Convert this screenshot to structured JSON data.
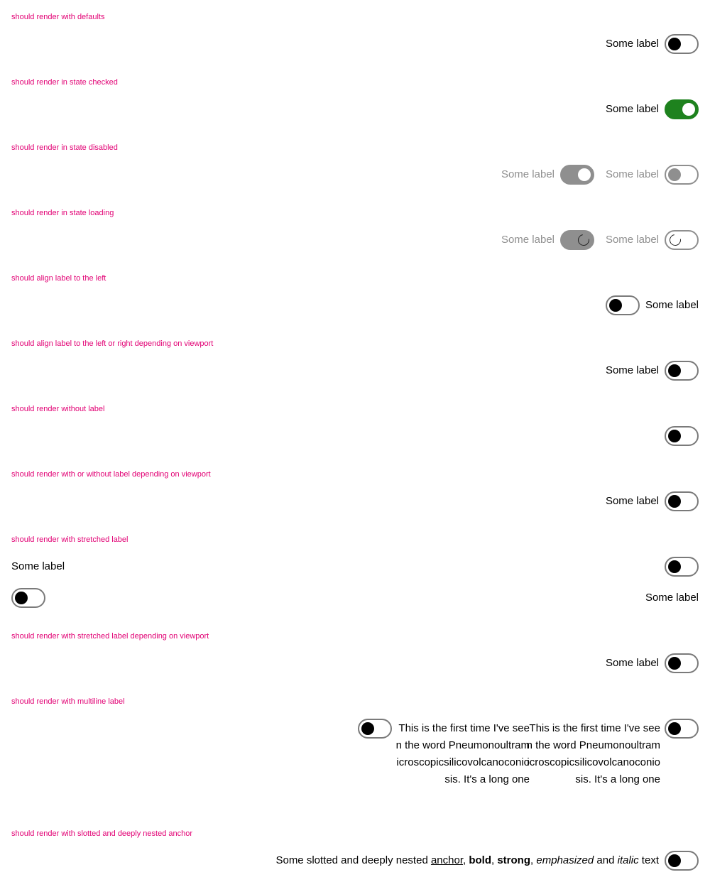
{
  "sections": {
    "defaults": "should render with defaults",
    "checked": "should render in state checked",
    "disabled": "should render in state disabled",
    "loading": "should render in state loading",
    "align_left": "should align label to the left",
    "align_viewport": "should align label to the left or right depending on viewport",
    "without_label": "should render without label",
    "with_or_without": "should render with or without label depending on viewport",
    "stretched": "should render with stretched label",
    "stretched_viewport": "should render with stretched label depending on viewport",
    "multiline": "should render with multiline label",
    "slotted": "should render with slotted and deeply nested anchor"
  },
  "label": "Some label",
  "switch_states": {
    "defaults": "off",
    "checked": "on",
    "disabled": [
      "disabled-on",
      "disabled-off"
    ],
    "loading": [
      "loading-on",
      "loading-off"
    ]
  },
  "multiline_text": "This is the first time I've seen the word Pneumonoultramicroscopicsilicovolcanoconiosis. It's a long one",
  "slotted": {
    "prefix": "Some slotted and deeply nested ",
    "anchor": "anchor",
    "sep1": ", ",
    "bold": "bold",
    "sep2": ", ",
    "strong": "strong",
    "sep3": ", ",
    "emphasized": "emphasized",
    "and": " and ",
    "italic": "italic",
    "suffix": " text"
  },
  "colors": {
    "accent": "#e20074",
    "checked": "#1e821e",
    "disabled": "#8f8f8f",
    "border": "#7a7a7a"
  }
}
